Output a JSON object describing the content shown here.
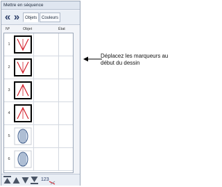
{
  "window": {
    "title": "Mettre en séquence"
  },
  "toolbar": {
    "prev_icon": "double-chevron-left-icon",
    "next_icon": "double-chevron-right-icon",
    "tabs": [
      "Objets",
      "Couleurs"
    ]
  },
  "columns": {
    "number": "Nº",
    "object": "Objet",
    "state": "État"
  },
  "rows": [
    {
      "number": "1",
      "thumb": "satin-v-down-icon"
    },
    {
      "number": "2",
      "thumb": "satin-v-down-icon"
    },
    {
      "number": "3",
      "thumb": "satin-v-up-icon"
    },
    {
      "number": "4",
      "thumb": "satin-v-up-icon"
    },
    {
      "number": "5",
      "thumb": "fill-oval-icon"
    },
    {
      "number": "6",
      "thumb": "fill-oval-icon"
    }
  ],
  "bottom_icons": [
    "move-to-top-icon",
    "move-up-icon",
    "move-down-icon",
    "move-to-bottom-icon",
    "renumber-icon"
  ],
  "callout": {
    "text": "Déplacez les marqueurs au début du dessin"
  },
  "colors": {
    "accent": "#d41e2a",
    "frame": "#000000"
  }
}
